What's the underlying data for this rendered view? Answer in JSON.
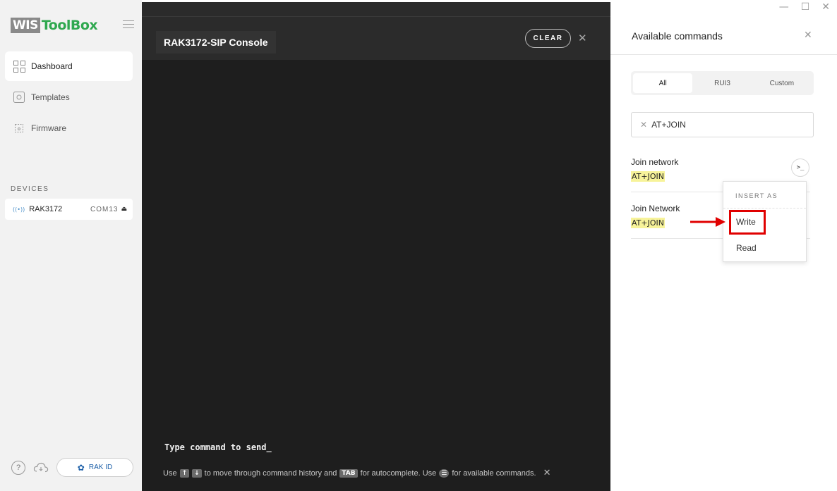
{
  "app": {
    "logo_wis": "WIS",
    "logo_toolbox": "ToolBox"
  },
  "sidebar": {
    "nav": [
      {
        "label": "Dashboard",
        "icon": "dashboard-icon",
        "active": true
      },
      {
        "label": "Templates",
        "icon": "templates-icon",
        "active": false
      },
      {
        "label": "Firmware",
        "icon": "firmware-icon",
        "active": false
      }
    ],
    "devices_label": "DEVICES",
    "device": {
      "name": "RAK3172",
      "port": "COM13",
      "signal_icon": "signal-icon",
      "eject_icon": "eject-icon"
    },
    "footer": {
      "help": "?",
      "rak_id_label": "RAK ID"
    }
  },
  "console": {
    "title": "RAK3172-SIP Console",
    "clear_label": "CLEAR",
    "prompt": "Type command to send_",
    "hint": {
      "use": "Use",
      "up_key": "↑",
      "down_key": "↓",
      "history_text": "to move through command history and",
      "tab_key": "TAB",
      "autocomplete_text": "for autocomplete. Use",
      "commands_text": "for available commands."
    }
  },
  "panel": {
    "title": "Available commands",
    "tabs": [
      {
        "label": "All",
        "active": true
      },
      {
        "label": "RUI3",
        "active": false
      },
      {
        "label": "Custom",
        "active": false
      }
    ],
    "search_value": "AT+JOIN",
    "commands": [
      {
        "name": "Join network",
        "code": "AT+JOIN"
      },
      {
        "name": "Join Network",
        "code": "AT+JOIN"
      }
    ],
    "insert_menu": {
      "label": "INSERT AS",
      "items": [
        "Write",
        "Read"
      ]
    }
  },
  "colors": {
    "brand_green": "#2fa84f",
    "console_bg": "#1e1e1e",
    "highlight_yellow": "#f7f39a",
    "annotation_red": "#e00000"
  }
}
